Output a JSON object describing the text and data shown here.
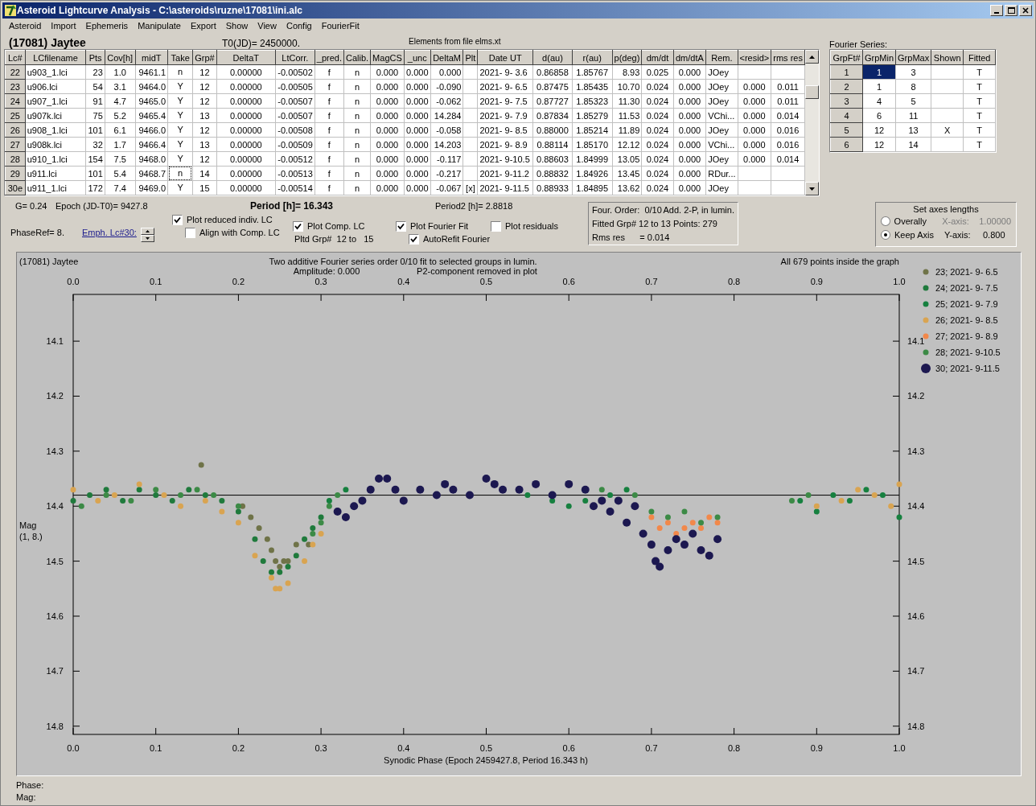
{
  "window": {
    "title": "Asteroid Lightcurve Analysis - C:\\asteroids\\ruzne\\17081\\ini.alc"
  },
  "menu": [
    "Asteroid",
    "Import",
    "Ephemeris",
    "Manipulate",
    "Export",
    "Show",
    "View",
    "Config",
    "FourierFit"
  ],
  "header": {
    "asteroid": "(17081) Jaytee",
    "t0": "T0(JD)= 2450000.",
    "elements": "Elements from file elms.xt"
  },
  "lc_table": {
    "columns": [
      "Lc#",
      "LCfilename",
      "Pts",
      "Cov[h]",
      "midT",
      "Take",
      "Grp#",
      "DeltaT",
      "LtCorr.",
      "_pred.",
      "Calib.",
      "MagCS",
      "_unc",
      "DeltaM",
      "Plt",
      "Date UT",
      "d(au)",
      "r(au)",
      "p(deg)",
      "dm/dt",
      "dm/dtA",
      "Rem.",
      "<resid>",
      "rms res"
    ],
    "rows": [
      {
        "take_focused": false,
        "cells": [
          "22",
          "u903_1.lci",
          "23",
          "1.0",
          "9461.1",
          "n",
          "12",
          "0.00000",
          "-0.00502",
          "f",
          "n",
          "0.000",
          "0.000",
          "0.000",
          null,
          "2021- 9- 3.6",
          "0.86858",
          "1.85767",
          "8.93",
          "0.025",
          "0.000",
          "JOey",
          null,
          null
        ]
      },
      {
        "take_focused": false,
        "cells": [
          "23",
          "u906.lci",
          "54",
          "3.1",
          "9464.0",
          "Y",
          "12",
          "0.00000",
          "-0.00505",
          "f",
          "n",
          "0.000",
          "0.000",
          "-0.090",
          null,
          "2021- 9- 6.5",
          "0.87475",
          "1.85435",
          "10.70",
          "0.024",
          "0.000",
          "JOey",
          "0.000",
          "0.011"
        ]
      },
      {
        "take_focused": false,
        "cells": [
          "24",
          "u907_1.lci",
          "91",
          "4.7",
          "9465.0",
          "Y",
          "12",
          "0.00000",
          "-0.00507",
          "f",
          "n",
          "0.000",
          "0.000",
          "-0.062",
          null,
          "2021- 9- 7.5",
          "0.87727",
          "1.85323",
          "11.30",
          "0.024",
          "0.000",
          "JOey",
          "0.000",
          "0.011"
        ]
      },
      {
        "take_focused": false,
        "cells": [
          "25",
          "u907k.lci",
          "75",
          "5.2",
          "9465.4",
          "Y",
          "13",
          "0.00000",
          "-0.00507",
          "f",
          "n",
          "0.000",
          "0.000",
          "14.284",
          null,
          "2021- 9- 7.9",
          "0.87834",
          "1.85279",
          "11.53",
          "0.024",
          "0.000",
          "VChi...",
          "0.000",
          "0.014"
        ]
      },
      {
        "take_focused": false,
        "cells": [
          "26",
          "u908_1.lci",
          "101",
          "6.1",
          "9466.0",
          "Y",
          "12",
          "0.00000",
          "-0.00508",
          "f",
          "n",
          "0.000",
          "0.000",
          "-0.058",
          null,
          "2021- 9- 8.5",
          "0.88000",
          "1.85214",
          "11.89",
          "0.024",
          "0.000",
          "JOey",
          "0.000",
          "0.016"
        ]
      },
      {
        "take_focused": false,
        "cells": [
          "27",
          "u908k.lci",
          "32",
          "1.7",
          "9466.4",
          "Y",
          "13",
          "0.00000",
          "-0.00509",
          "f",
          "n",
          "0.000",
          "0.000",
          "14.203",
          null,
          "2021- 9- 8.9",
          "0.88114",
          "1.85170",
          "12.12",
          "0.024",
          "0.000",
          "VChi...",
          "0.000",
          "0.016"
        ]
      },
      {
        "take_focused": false,
        "cells": [
          "28",
          "u910_1.lci",
          "154",
          "7.5",
          "9468.0",
          "Y",
          "12",
          "0.00000",
          "-0.00512",
          "f",
          "n",
          "0.000",
          "0.000",
          "-0.117",
          null,
          "2021- 9-10.5",
          "0.88603",
          "1.84999",
          "13.05",
          "0.024",
          "0.000",
          "JOey",
          "0.000",
          "0.014"
        ]
      },
      {
        "take_focused": true,
        "cells": [
          "29",
          "u911.lci",
          "101",
          "5.4",
          "9468.7",
          "n",
          "14",
          "0.00000",
          "-0.00513",
          "f",
          "n",
          "0.000",
          "0.000",
          "-0.217",
          null,
          "2021- 9-11.2",
          "0.88832",
          "1.84926",
          "13.45",
          "0.024",
          "0.000",
          "RDur...",
          null,
          null
        ]
      },
      {
        "take_focused": false,
        "cells": [
          "30e",
          "u911_1.lci",
          "172",
          "7.4",
          "9469.0",
          "Y",
          "15",
          "0.00000",
          "-0.00514",
          "f",
          "n",
          "0.000",
          "0.000",
          "-0.067",
          "[x]",
          "2021- 9-11.5",
          "0.88933",
          "1.84895",
          "13.62",
          "0.024",
          "0.000",
          "JOey",
          null,
          null
        ]
      }
    ]
  },
  "fourier": {
    "label": "Fourier Series:",
    "columns": [
      "GrpFt#",
      "GrpMin",
      "GrpMax",
      "Shown",
      "Fitted"
    ],
    "rows": [
      {
        "grp": "1",
        "min": "1",
        "max": "3",
        "fitted": "T",
        "selected": true
      },
      {
        "grp": "2",
        "min": "1",
        "max": "8",
        "fitted": "T",
        "selected": false
      },
      {
        "grp": "3",
        "min": "4",
        "max": "5",
        "fitted": "T",
        "selected": false
      },
      {
        "grp": "4",
        "min": "6",
        "max": "11",
        "fitted": "T",
        "selected": false
      },
      {
        "grp": "5",
        "min": "12",
        "max": "13",
        "shown": "X",
        "fitted": "T",
        "selected": false
      },
      {
        "grp": "6",
        "min": "12",
        "max": "14",
        "fitted": "T",
        "selected": false
      }
    ]
  },
  "controls": {
    "g": "G= 0.24",
    "epoch": "Epoch (JD-T0)= 9427.8",
    "period": "Period [h]= 16.343",
    "period2": "Period2 [h]= 2.8818",
    "phase_ref": "PhaseRef= 8.",
    "emph_link": "Emph. Lc#30:",
    "option_columns": [
      {
        "checkboxes": [
          {
            "label": "Plot reduced indiv. LC",
            "checked": true
          },
          {
            "label": "Align with Comp. LC",
            "checked": false
          }
        ]
      },
      {
        "checkboxes": [
          {
            "label": "Plot Comp. LC",
            "checked": true
          }
        ],
        "note": "Pltd Grp#  12 to   15"
      },
      {
        "checkboxes": [
          {
            "label": "Plot Fourier Fit",
            "checked": true
          },
          {
            "label": "AutoRefit Fourier",
            "checked": true
          }
        ]
      },
      {
        "checkboxes": [
          {
            "label": "Plot residuals",
            "checked": false
          }
        ]
      }
    ]
  },
  "fit_info": {
    "order": "Four. Order:  0/10",
    "mode": "Add. 2-P, in lumin.",
    "fitted": "Fitted Grp# 12 to 13 Points: 279",
    "rms": "Rms res      = 0.014"
  },
  "axes_group": {
    "title": "Set axes lengths",
    "options": [
      {
        "label": "Overally",
        "selected": false,
        "axis_label": "X-axis:",
        "value": "1.00000",
        "disabled": true
      },
      {
        "label": "Keep Axis",
        "selected": true,
        "axis_label": "Y-axis:",
        "value": "0.800",
        "disabled": false
      }
    ]
  },
  "plot": {
    "title": "(17081) Jaytee",
    "subtitle": "Two additive Fourier series order 0/10 fit to selected groups in lumin.",
    "amplitude": "Amplitude: 0.000",
    "p2_note": "P2-component removed in plot",
    "points_note": "All 679 points inside the graph",
    "ylabel_note": "(1, 8.)",
    "series_emphasis": [
      false,
      false,
      false,
      false,
      false,
      false,
      true
    ],
    "chart_data": {
      "type": "scatter",
      "legend": "right",
      "xlabel": "Synodic Phase (Epoch 2459427.8, Period 16.343 h)",
      "ylabel": "Mag",
      "xlim": [
        0,
        1
      ],
      "ylim": [
        14.815,
        14.015
      ],
      "xticks": [
        {
          "value": 0,
          "label": "0.0"
        },
        {
          "value": 0.1,
          "label": "0.1"
        },
        {
          "value": 0.2,
          "label": "0.2"
        },
        {
          "value": 0.3,
          "label": "0.3"
        },
        {
          "value": 0.4,
          "label": "0.4"
        },
        {
          "value": 0.5,
          "label": "0.5"
        },
        {
          "value": 0.6,
          "label": "0.6"
        },
        {
          "value": 0.7,
          "label": "0.7"
        },
        {
          "value": 0.8,
          "label": "0.8"
        },
        {
          "value": 0.9,
          "label": "0.9"
        },
        {
          "value": 1,
          "label": "1.0"
        }
      ],
      "yticks": [
        {
          "value": 14.1,
          "label": "14.1"
        },
        {
          "value": 14.2,
          "label": "14.2"
        },
        {
          "value": 14.3,
          "label": "14.3"
        },
        {
          "value": 14.4,
          "label": "14.4"
        },
        {
          "value": 14.5,
          "label": "14.5"
        },
        {
          "value": 14.6,
          "label": "14.6"
        },
        {
          "value": 14.7,
          "label": "14.7"
        },
        {
          "value": 14.8,
          "label": "14.8"
        }
      ],
      "ref_lines": [
        {
          "axis": "y",
          "value": 14.38
        }
      ],
      "series": [
        {
          "name": "23; 2021- 9- 6.5",
          "color": "#6f7348",
          "x": [
            0.155,
            0.205,
            0.215,
            0.225,
            0.235,
            0.24,
            0.245,
            0.25,
            0.255,
            0.26,
            0.27,
            0.285
          ],
          "values": [
            14.325,
            14.4,
            14.42,
            14.44,
            14.46,
            14.48,
            14.5,
            14.51,
            14.5,
            14.5,
            14.47,
            14.47
          ]
        },
        {
          "name": "24; 2021- 9- 7.5",
          "color": "#1f7a3c",
          "x": [
            0.0,
            0.02,
            0.04,
            0.06,
            0.08,
            0.1,
            0.12,
            0.14,
            0.16,
            0.18,
            0.2,
            0.22,
            0.23,
            0.24,
            0.25,
            0.26,
            0.27,
            0.28,
            0.29,
            0.3
          ],
          "values": [
            14.39,
            14.38,
            14.37,
            14.39,
            14.37,
            14.38,
            14.39,
            14.37,
            14.38,
            14.39,
            14.41,
            14.46,
            14.5,
            14.52,
            14.52,
            14.51,
            14.49,
            14.46,
            14.44,
            14.42
          ]
        },
        {
          "name": "25; 2021- 9- 7.9",
          "color": "#16803f",
          "x": [
            0.31,
            0.33,
            0.55,
            0.58,
            0.6,
            0.62,
            0.65,
            0.67,
            0.88,
            0.9,
            0.92,
            0.94,
            0.96,
            0.98,
            1.0
          ],
          "values": [
            14.39,
            14.37,
            14.38,
            14.39,
            14.4,
            14.39,
            14.38,
            14.37,
            14.39,
            14.41,
            14.38,
            14.39,
            14.37,
            14.38,
            14.42
          ]
        },
        {
          "name": "26; 2021- 9- 8.5",
          "color": "#d9a451",
          "x": [
            0.0,
            0.03,
            0.05,
            0.08,
            0.11,
            0.13,
            0.16,
            0.18,
            0.2,
            0.22,
            0.24,
            0.245,
            0.25,
            0.26,
            0.28,
            0.29,
            0.3,
            0.9,
            0.93,
            0.95,
            0.97,
            0.99,
            1.0
          ],
          "values": [
            14.37,
            14.39,
            14.38,
            14.36,
            14.38,
            14.4,
            14.39,
            14.41,
            14.43,
            14.49,
            14.53,
            14.55,
            14.55,
            14.54,
            14.5,
            14.47,
            14.45,
            14.4,
            14.39,
            14.37,
            14.38,
            14.4,
            14.36
          ]
        },
        {
          "name": "27; 2021- 9- 8.9",
          "color": "#f2884a",
          "x": [
            0.7,
            0.71,
            0.72,
            0.73,
            0.74,
            0.75,
            0.76,
            0.77,
            0.78
          ],
          "values": [
            14.42,
            14.44,
            14.43,
            14.45,
            14.44,
            14.43,
            14.44,
            14.42,
            14.43
          ]
        },
        {
          "name": "28; 2021- 9-10.5",
          "color": "#3c8a46",
          "x": [
            0.01,
            0.04,
            0.07,
            0.1,
            0.13,
            0.15,
            0.17,
            0.2,
            0.29,
            0.3,
            0.31,
            0.32,
            0.64,
            0.68,
            0.7,
            0.72,
            0.74,
            0.76,
            0.78,
            0.87,
            0.89
          ],
          "values": [
            14.4,
            14.38,
            14.39,
            14.37,
            14.38,
            14.37,
            14.38,
            14.4,
            14.45,
            14.43,
            14.4,
            14.38,
            14.37,
            14.38,
            14.41,
            14.42,
            14.41,
            14.43,
            14.42,
            14.39,
            14.38
          ]
        },
        {
          "name": "30; 2021- 9-11.5",
          "color": "#1c1850",
          "x": [
            0.32,
            0.33,
            0.34,
            0.35,
            0.36,
            0.37,
            0.38,
            0.39,
            0.4,
            0.42,
            0.44,
            0.45,
            0.46,
            0.48,
            0.5,
            0.51,
            0.52,
            0.54,
            0.56,
            0.58,
            0.6,
            0.62,
            0.63,
            0.64,
            0.65,
            0.66,
            0.67,
            0.68,
            0.69,
            0.7,
            0.705,
            0.71,
            0.72,
            0.73,
            0.74,
            0.75,
            0.76,
            0.77,
            0.78
          ],
          "values": [
            14.41,
            14.42,
            14.4,
            14.39,
            14.37,
            14.35,
            14.35,
            14.37,
            14.39,
            14.37,
            14.38,
            14.36,
            14.37,
            14.38,
            14.35,
            14.36,
            14.37,
            14.37,
            14.36,
            14.38,
            14.36,
            14.37,
            14.4,
            14.39,
            14.41,
            14.39,
            14.43,
            14.4,
            14.45,
            14.47,
            14.5,
            14.51,
            14.48,
            14.46,
            14.47,
            14.45,
            14.48,
            14.49,
            14.46
          ]
        }
      ]
    }
  },
  "status": [
    "Phase:",
    "Mag:"
  ]
}
